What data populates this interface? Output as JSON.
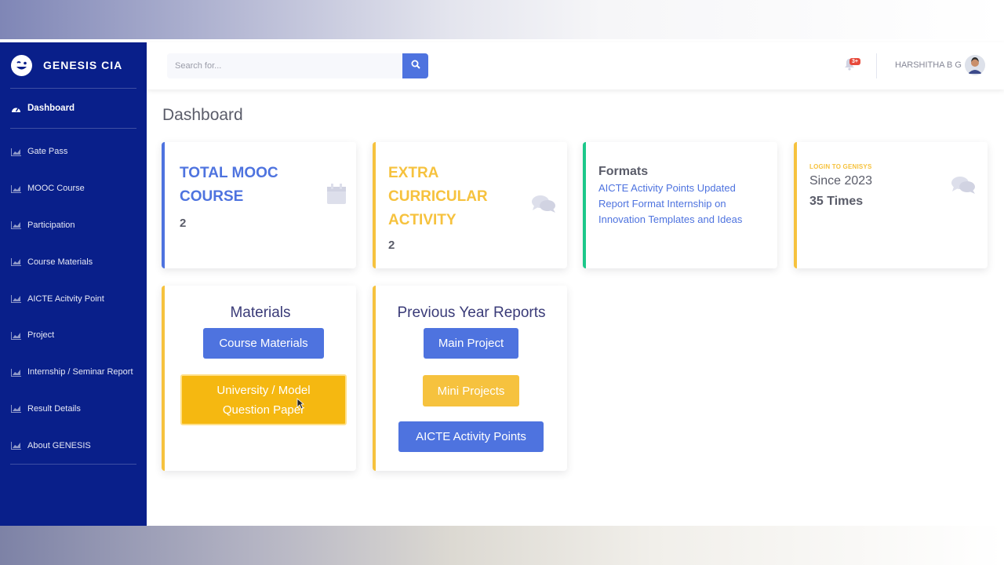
{
  "brand": {
    "name": "GENESIS CIA"
  },
  "sidebar": {
    "items": [
      {
        "label": "Dashboard"
      },
      {
        "label": "Gate Pass"
      },
      {
        "label": "MOOC Course"
      },
      {
        "label": "Participation"
      },
      {
        "label": "Course Materials"
      },
      {
        "label": "AICTE Acitvity Point"
      },
      {
        "label": "Project"
      },
      {
        "label": "Internship / Seminar Report"
      },
      {
        "label": "Result Details"
      },
      {
        "label": "About GENESIS"
      }
    ]
  },
  "topbar": {
    "search_placeholder": "Search for...",
    "notifications_badge": "3+",
    "user_name": "HARSHITHA B G"
  },
  "page": {
    "title": "Dashboard"
  },
  "cards": {
    "mooc": {
      "title_line1": "TOTAL MOOC",
      "title_line2": "COURSE",
      "value": "2"
    },
    "extra": {
      "title_line1": "EXTRA",
      "title_line2": "CURRICULAR",
      "title_line3": "ACTIVITY",
      "value": "2"
    },
    "formats": {
      "title": "Formats",
      "text": "AICTE Activity Points Updated Report Format Internship on Innovation Templates and Ideas"
    },
    "login": {
      "label": "LOGIN TO GENISYS",
      "since": "Since 2023",
      "times": "35 Times"
    }
  },
  "materials": {
    "title": "Materials",
    "course_materials": "Course Materials",
    "question_paper_line1": "University / Model",
    "question_paper_line2": "Question Paper"
  },
  "reports": {
    "title": "Previous Year Reports",
    "main_project": "Main Project",
    "mini_projects": "Mini Projects",
    "aicte_points": "AICTE Activity Points"
  },
  "colors": {
    "sidebar": "#091f8a",
    "primary": "#4e73df",
    "warning": "#f6c23e",
    "success": "#1cc88a",
    "danger": "#e74a3b"
  },
  "icons": {
    "brand": "laugh-wink-icon",
    "dashboard": "tachometer-icon",
    "nav": "chart-area-icon",
    "search": "search-icon",
    "bell": "bell-icon",
    "calendar": "calendar-icon",
    "comments": "comments-icon"
  }
}
